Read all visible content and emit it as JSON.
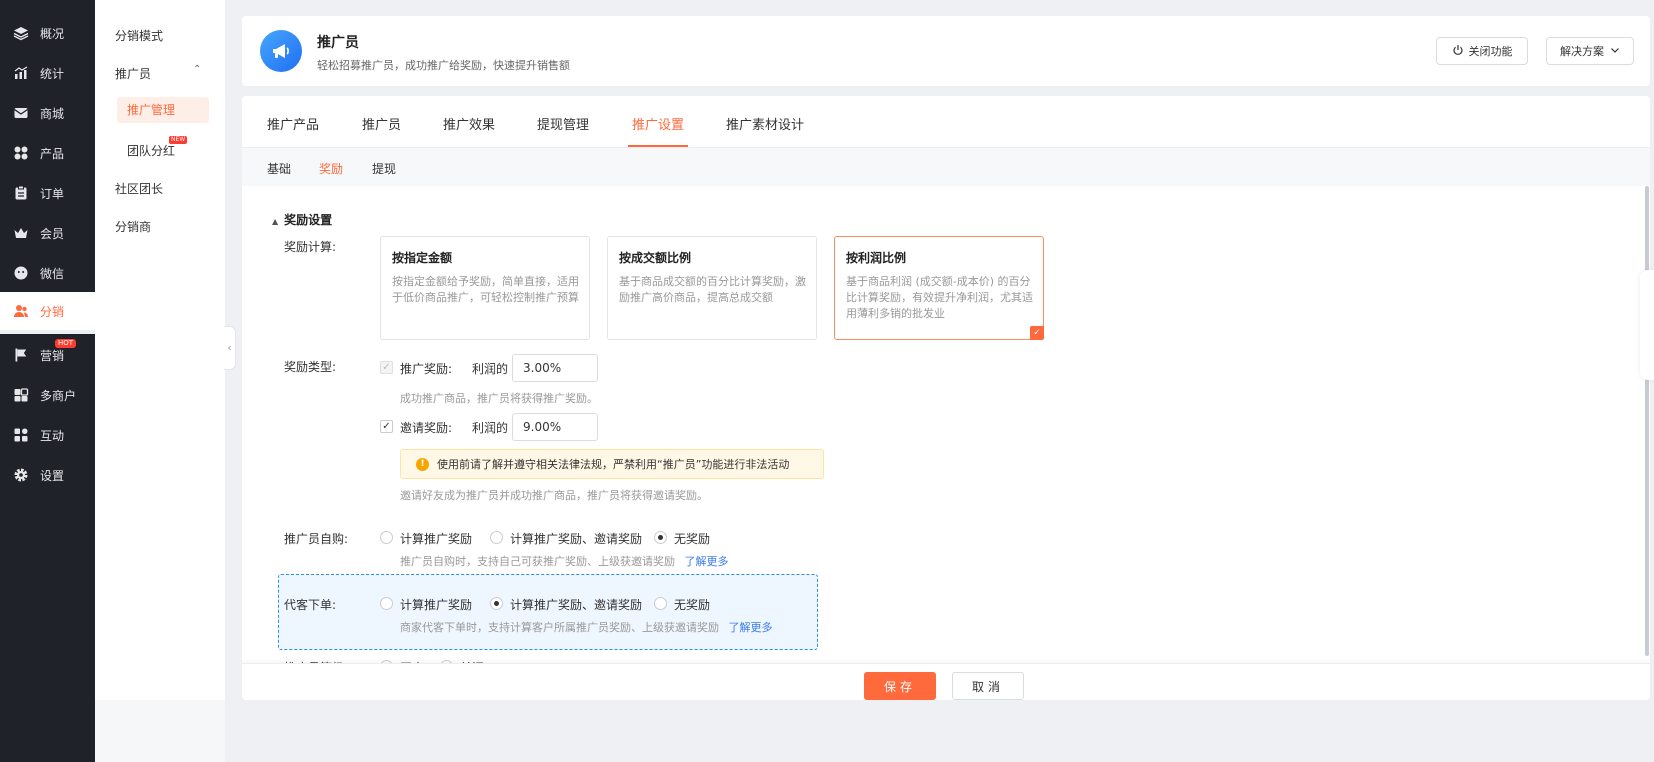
{
  "nav": {
    "items": [
      {
        "label": "概况",
        "icon": "layers-icon"
      },
      {
        "label": "统计",
        "icon": "chart-icon"
      },
      {
        "label": "商城",
        "icon": "mail-icon"
      },
      {
        "label": "产品",
        "icon": "grid-icon"
      },
      {
        "label": "订单",
        "icon": "clipboard-icon"
      },
      {
        "label": "会员",
        "icon": "crown-icon"
      },
      {
        "label": "微信",
        "icon": "wechat-icon"
      },
      {
        "label": "分销",
        "icon": "users-icon"
      },
      {
        "label": "营销",
        "icon": "flag-icon",
        "badge": "HOT"
      },
      {
        "label": "多商户",
        "icon": "store-icon"
      },
      {
        "label": "互动",
        "icon": "apps-icon"
      },
      {
        "label": "设置",
        "icon": "gear-icon"
      }
    ]
  },
  "sub": {
    "mode": "分销模式",
    "promoter": "推广员",
    "promoter_manage": "推广管理",
    "team_dividend": "团队分红",
    "team_badge": "NEW",
    "community": "社区团长",
    "distributor": "分销商"
  },
  "header": {
    "title": "推广员",
    "subtitle": "轻松招募推广员，成功推广给奖励，快速提升销售额",
    "close_btn": "关闭功能",
    "solution_btn": "解决方案"
  },
  "tabs": [
    "推广产品",
    "推广员",
    "推广效果",
    "提现管理",
    "推广设置",
    "推广素材设计"
  ],
  "subtabs": [
    "基础",
    "奖励",
    "提现"
  ],
  "section_title": "奖励设置",
  "reward_calc": {
    "label": "奖励计算:",
    "cards": [
      {
        "title": "按指定金额",
        "desc": "按指定金额给予奖励，简单直接，适用于低价商品推广，可轻松控制推广预算"
      },
      {
        "title": "按成交额比例",
        "desc": "基于商品成交额的百分比计算奖励，激励推广高价商品，提高总成交额"
      },
      {
        "title": "按利润比例",
        "desc": "基于商品利润 (成交额-成本价) 的百分比计算奖励，有效提升净利润，尤其适用薄利多销的批发业"
      }
    ]
  },
  "reward_type": {
    "label": "奖励类型:",
    "promo_label": "推广奖励:",
    "promo_of": "利润的",
    "promo_value": "3.00%",
    "promo_hint": "成功推广商品，推广员将获得推广奖励。",
    "invite_label": "邀请奖励:",
    "invite_of": "利润的",
    "invite_value": "9.00%",
    "notice": "使用前请了解并遵守相关法律法规，严禁利用“推广员”功能进行非法活动",
    "invite_hint": "邀请好友成为推广员并成功推广商品，推广员将获得邀请奖励。"
  },
  "self_purchase": {
    "label": "推广员自购:",
    "options": [
      "计算推广奖励",
      "计算推广奖励、邀请奖励",
      "无奖励"
    ],
    "hint": "推广员自购时，支持自己可获推广奖励、上级获邀请奖励",
    "more": "了解更多"
  },
  "proxy_order": {
    "label": "代客下单:",
    "options": [
      "计算推广奖励",
      "计算推广奖励、邀请奖励",
      "无奖励"
    ],
    "hint": "商家代客下单时，支持计算客户所属推广员奖励、上级获邀请奖励",
    "more": "了解更多"
  },
  "level": {
    "label": "推广员等级:",
    "options": [
      "开启",
      "关闭"
    ]
  },
  "footer": {
    "save": "保存",
    "cancel": "取消"
  },
  "colors": {
    "accent": "#ff6a3d",
    "nav_bg": "#1f2228",
    "link": "#3a7af0"
  }
}
